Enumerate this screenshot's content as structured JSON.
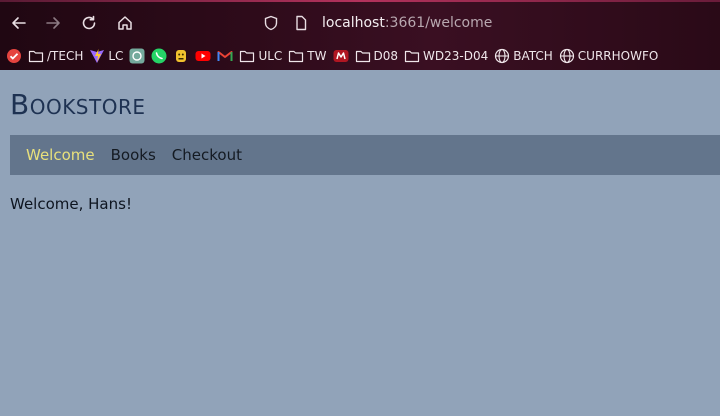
{
  "browser": {
    "url_host": "localhost",
    "url_rest": ":3661/welcome",
    "bookmarks": [
      {
        "icon": "red-check-icon",
        "label": ""
      },
      {
        "icon": "folder-icon",
        "label": "/TECH"
      },
      {
        "icon": "vite-icon",
        "label": "LC"
      },
      {
        "icon": "chatgpt-icon",
        "label": ""
      },
      {
        "icon": "whatsapp-icon",
        "label": ""
      },
      {
        "icon": "yellow-mascot-icon",
        "label": ""
      },
      {
        "icon": "youtube-icon",
        "label": ""
      },
      {
        "icon": "gmail-icon",
        "label": ""
      },
      {
        "icon": "folder-icon",
        "label": "ULC"
      },
      {
        "icon": "folder-icon",
        "label": "TW"
      },
      {
        "icon": "red-m-icon",
        "label": ""
      },
      {
        "icon": "folder-icon",
        "label": "D08"
      },
      {
        "icon": "folder-icon",
        "label": "WD23-D04"
      },
      {
        "icon": "globe-icon",
        "label": "BATCH"
      },
      {
        "icon": "globe-icon",
        "label": "CURRHOWFO"
      }
    ],
    "colors": {
      "chrome_bg": "#2e0b1a",
      "accent": "#b3325c"
    }
  },
  "page": {
    "title": "Bookstore",
    "nav": [
      {
        "label": "Welcome",
        "active": true
      },
      {
        "label": "Books",
        "active": false
      },
      {
        "label": "Checkout",
        "active": false
      }
    ],
    "welcome_text": "Welcome, Hans!",
    "colors": {
      "background": "#91a3b9",
      "navbar": "#63758c",
      "active_link": "#e8e07c",
      "title": "#1e3252"
    }
  }
}
